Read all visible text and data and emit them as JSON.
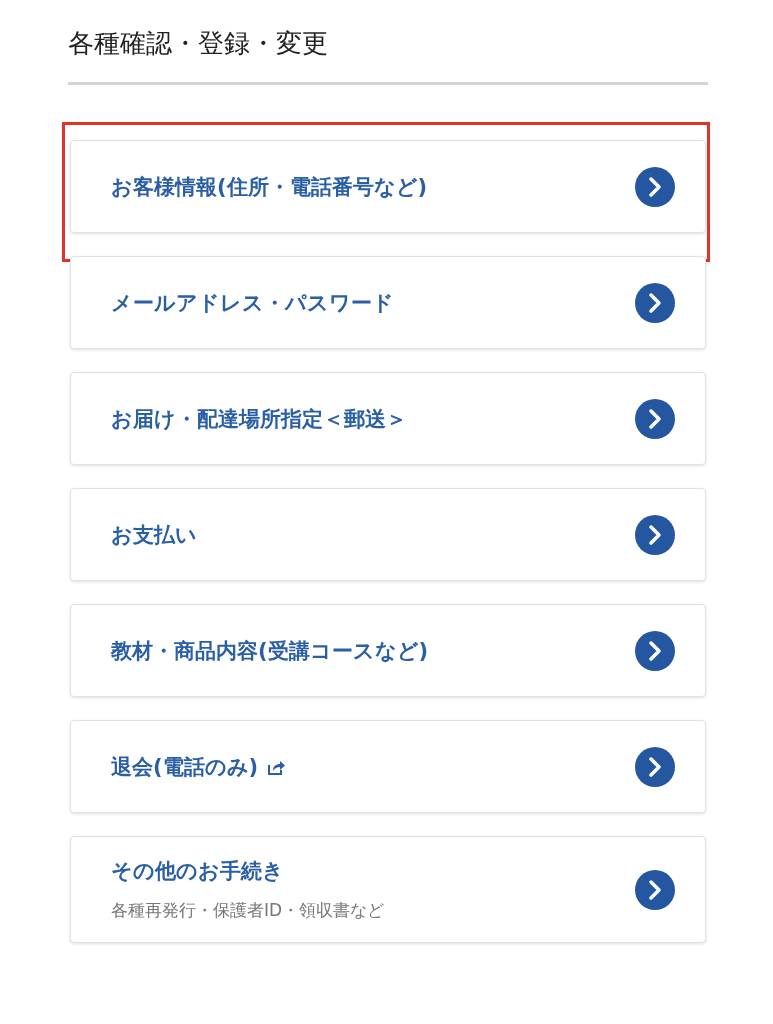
{
  "title": "各種確認・登録・変更",
  "items": [
    {
      "label": "お客様情報(住所・電話番号など)",
      "highlighted": true,
      "external": false
    },
    {
      "label": "メールアドレス・パスワード",
      "highlighted": false,
      "external": false
    },
    {
      "label": "お届け・配達場所指定＜郵送＞",
      "highlighted": false,
      "external": false
    },
    {
      "label": "お支払い",
      "highlighted": false,
      "external": false
    },
    {
      "label": "教材・商品内容(受講コースなど)",
      "highlighted": false,
      "external": false
    },
    {
      "label": "退会(電話のみ)",
      "highlighted": false,
      "external": true
    },
    {
      "label": "その他のお手続き",
      "sublabel": "各種再発行・保護者ID・領収書など",
      "highlighted": false,
      "external": false
    }
  ]
}
